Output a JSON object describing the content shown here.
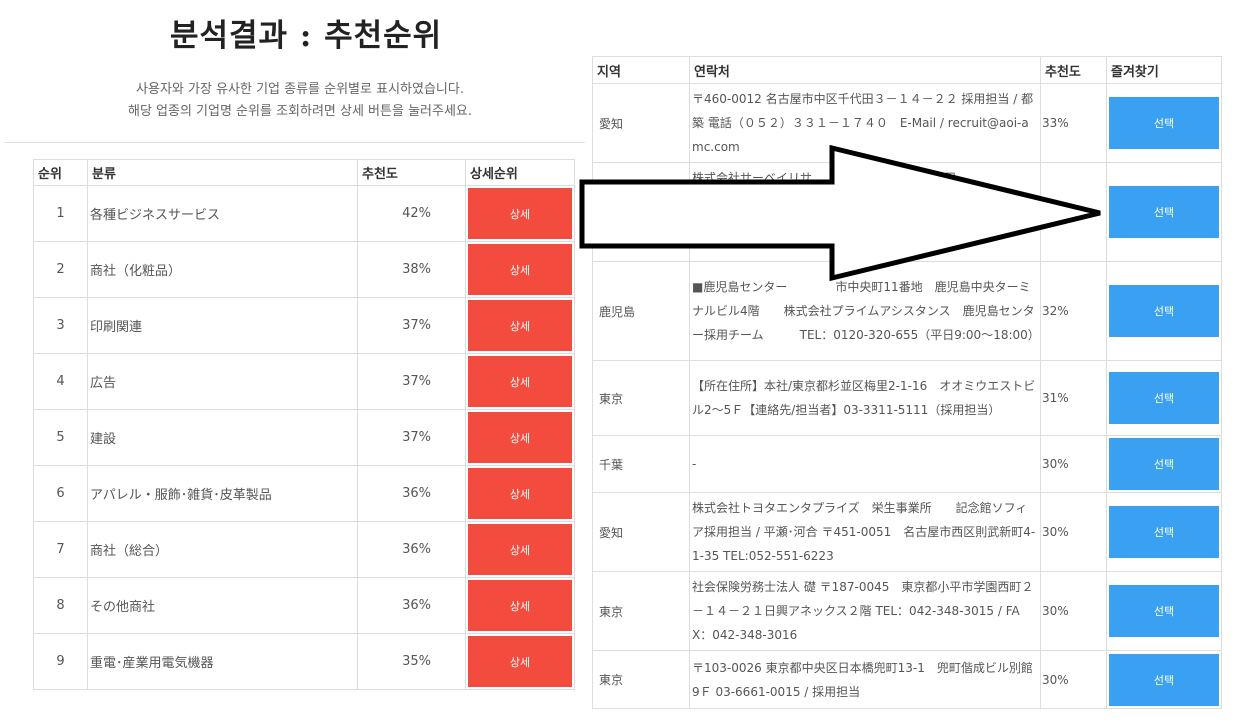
{
  "page": {
    "title": "분석결과 : 추천순위",
    "desc_line1": "사용자와 가장 유사한 기업 종류를 순위별로 표시하였습니다.",
    "desc_line2": "해당 업종의 기업명 순위를 조회하려면 상세 버튼을 눌러주세요."
  },
  "ranking_table": {
    "headers": {
      "rank": "순위",
      "category": "분류",
      "score": "추천도",
      "detail": "상세순위"
    },
    "rows": [
      {
        "rank": "1",
        "category": "各種ビジネスサービス",
        "score": "42%",
        "button": "상세"
      },
      {
        "rank": "2",
        "category": "商社（化粧品）",
        "score": "38%",
        "button": "상세"
      },
      {
        "rank": "3",
        "category": "印刷関連",
        "score": "37%",
        "button": "상세"
      },
      {
        "rank": "4",
        "category": "広告",
        "score": "37%",
        "button": "상세"
      },
      {
        "rank": "5",
        "category": "建設",
        "score": "37%",
        "button": "상세"
      },
      {
        "rank": "6",
        "category": "アパレル・服飾･雑貨･皮革製品",
        "score": "36%",
        "button": "상세"
      },
      {
        "rank": "7",
        "category": "商社（総合）",
        "score": "36%",
        "button": "상세"
      },
      {
        "rank": "8",
        "category": "その他商社",
        "score": "36%",
        "button": "상세"
      },
      {
        "rank": "9",
        "category": "重電･産業用電気機器",
        "score": "35%",
        "button": "상세"
      }
    ]
  },
  "company_table": {
    "headers": {
      "region": "지역",
      "contact": "연락처",
      "score": "추천도",
      "favorite": "즐겨찾기"
    },
    "rows": [
      {
        "region": "愛知",
        "contact": "〒460-0012 名古屋市中区千代田３－１４－２２ 採用担当 / 都築 電話（０５２）３３１－１７４０　E-Mail / recruit@aoi-amc.com",
        "score": "33%",
        "button": "선택"
      },
      {
        "region": "",
        "contact": "株式会社サーベイリサ　　　　　本部　新卒採用",
        "score": "",
        "button": "선택"
      },
      {
        "region": "鹿児島",
        "contact": "■鹿児島センター　　　　市中央町11番地　鹿児島中央ターミナルビル4階　　株式会社プライムアシスタンス　鹿児島センター採用チーム　　　TEL：0120-320-655（平日9:00～18:00）",
        "score": "32%",
        "button": "선택"
      },
      {
        "region": "東京",
        "contact": "【所在住所】本社/東京都杉並区梅里2-1-16　オオミウエストビル2～5Ｆ【連絡先/担当者】03-3311-5111（採用担当）",
        "score": "31%",
        "button": "선택"
      },
      {
        "region": "千葉",
        "contact": "-",
        "score": "30%",
        "button": "선택"
      },
      {
        "region": "愛知",
        "contact": "株式会社トヨタエンタプライズ　栄生事業所　　記念館ソフィア採用担当 / 平瀬･河合 〒451-0051　名古屋市西区則武新町4-1-35 TEL:052-551-6223",
        "score": "30%",
        "button": "선택"
      },
      {
        "region": "東京",
        "contact": "社会保険労務士法人 礎 〒187-0045　東京都小平市学園西町２－１４－２１日興アネックス２階 TEL：042-348-3015 / FAX：042-348-3016",
        "score": "30%",
        "button": "선택"
      },
      {
        "region": "東京",
        "contact": "〒103-0026 東京都中央区日本橋兜町13-1　兜町偕成ビル別館9Ｆ 03-6661-0015 / 採用担当",
        "score": "30%",
        "button": "선택"
      }
    ]
  },
  "annotation": {
    "arrow": "right-arrow-overlay"
  }
}
